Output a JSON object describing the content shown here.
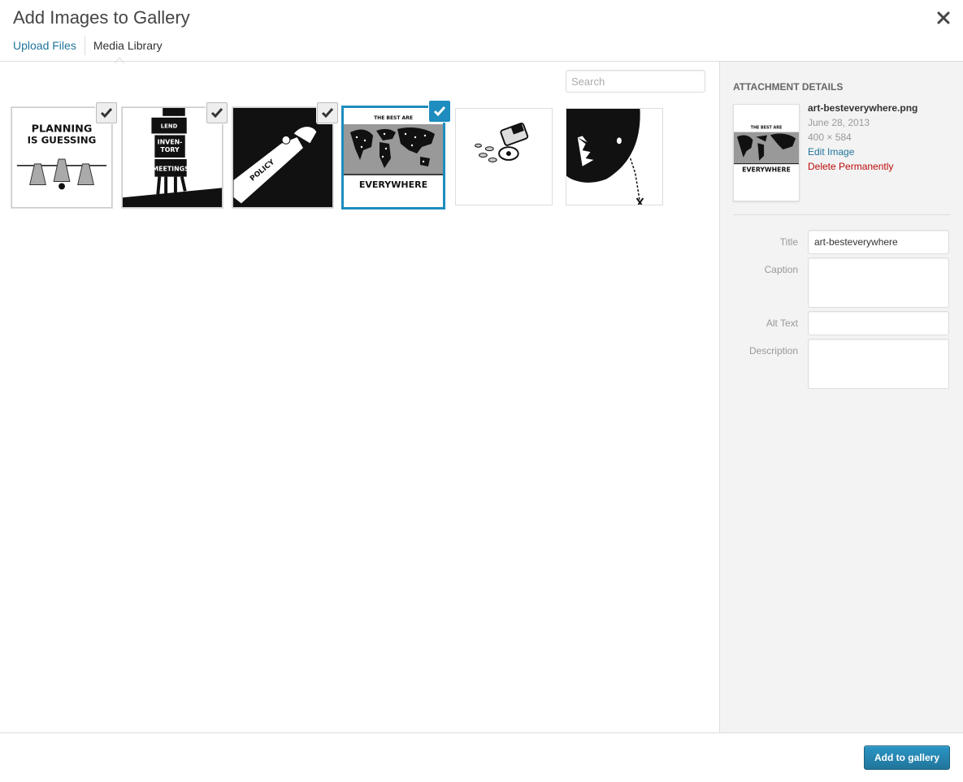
{
  "header": {
    "title": "Add Images to Gallery",
    "close_icon": "close-icon"
  },
  "router": {
    "upload_files": "Upload Files",
    "media_library": "Media Library"
  },
  "search": {
    "placeholder": "Search",
    "value": ""
  },
  "attachments": [
    {
      "name": "planning-is-guessing",
      "text_lines": [
        "PLANNING",
        "IS GUESSING"
      ],
      "selected": true,
      "details": false
    },
    {
      "name": "inventory-meetings",
      "text_lines": [
        "LEND",
        "INVEN-",
        "TORY",
        "MEETINGS"
      ],
      "selected": true,
      "details": false
    },
    {
      "name": "policy-arm",
      "text_lines": [
        "POLICY"
      ],
      "selected": true,
      "details": false
    },
    {
      "name": "art-besteverywhere",
      "text_lines": [
        "THE BEST ARE",
        "EVERYWHERE"
      ],
      "selected": true,
      "details": true
    },
    {
      "name": "pill-bottle",
      "text_lines": [],
      "selected": false,
      "details": false
    },
    {
      "name": "shark",
      "text_lines": [],
      "selected": false,
      "details": false
    }
  ],
  "sidebar": {
    "heading": "Attachment Details",
    "filename": "art-besteverywhere.png",
    "date": "June 28, 2013",
    "dimensions": "400 × 584",
    "edit_image": "Edit Image",
    "delete_permanently": "Delete Permanently",
    "fields": {
      "title_label": "Title",
      "title_value": "art-besteverywhere",
      "caption_label": "Caption",
      "caption_value": "",
      "alt_label": "Alt Text",
      "alt_value": "",
      "description_label": "Description",
      "description_value": ""
    }
  },
  "footer": {
    "add_button": "Add to gallery"
  },
  "colors": {
    "accent": "#1e8cbe",
    "link": "#21759b",
    "delete": "#bc0b0b",
    "button": "#21759b"
  }
}
